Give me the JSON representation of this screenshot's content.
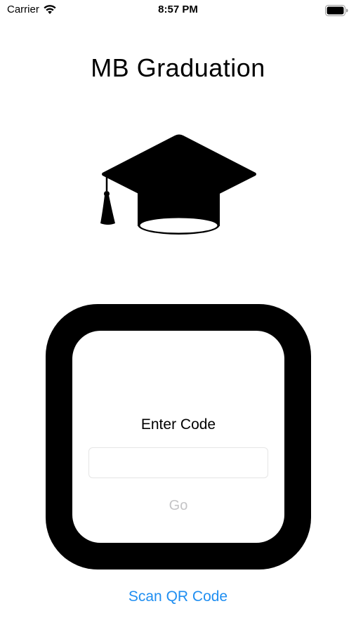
{
  "status_bar": {
    "carrier": "Carrier",
    "time": "8:57 PM",
    "wifi_icon": "wifi-icon",
    "battery_icon": "battery-icon"
  },
  "header": {
    "title": "MB Graduation",
    "logo_icon": "graduation-cap-icon"
  },
  "code_entry": {
    "label": "Enter Code",
    "input_value": "",
    "input_placeholder": "",
    "go_label": "Go"
  },
  "scan_link": {
    "label": "Scan QR Code"
  },
  "colors": {
    "accent": "#1f8ef1",
    "disabled_text": "#c4c4c6",
    "frame": "#000000"
  }
}
